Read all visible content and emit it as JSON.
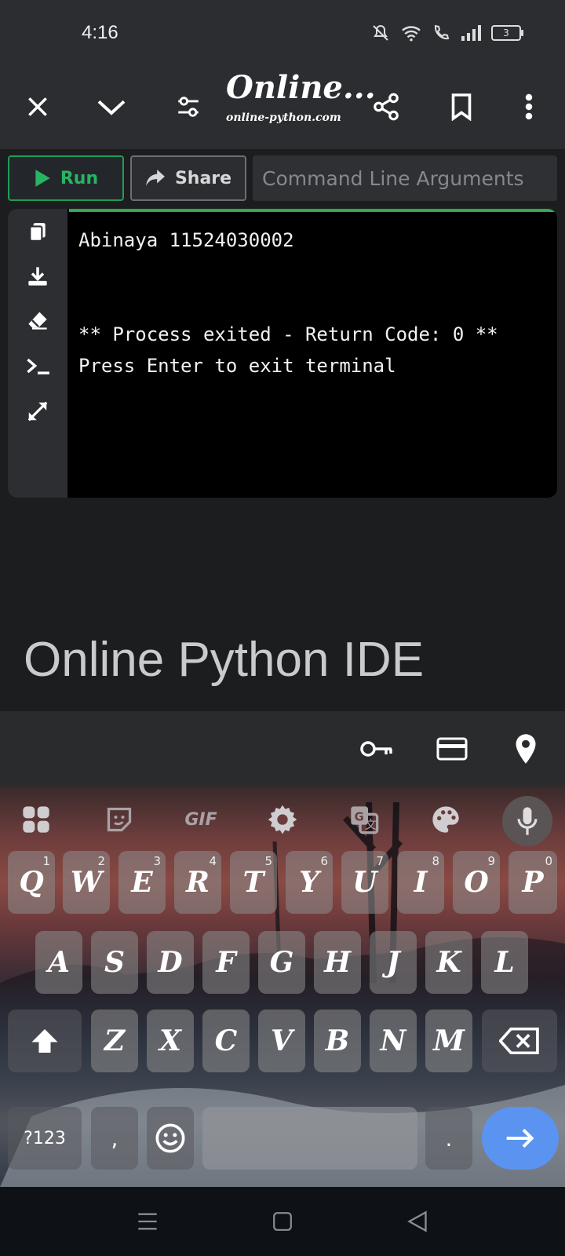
{
  "status": {
    "time": "4:16",
    "battery": "3"
  },
  "browser": {
    "title": "Online...",
    "domain": "online-python.com",
    "icons": [
      "close-icon",
      "chevron-down-icon",
      "tune-icon",
      "share-icon",
      "bookmark-icon",
      "more-vert-icon"
    ]
  },
  "controls": {
    "run_label": "Run",
    "share_label": "Share",
    "args_placeholder": "Command Line Arguments"
  },
  "terminal": {
    "sidebar_icons": [
      "copy-icon",
      "download-icon",
      "eraser-icon",
      "terminal-icon",
      "expand-icon"
    ],
    "lines": [
      "Abinaya 11524030002",
      "",
      "",
      "** Process exited - Return Code: 0 **",
      "Press Enter to exit terminal"
    ]
  },
  "heading": "Online Python IDE",
  "autofill": {
    "icons": [
      "key-icon",
      "credit-card-icon",
      "location-pin-icon"
    ]
  },
  "keyboard": {
    "toolbar": {
      "gif_label": "GIF",
      "icons": [
        "apps-grid-icon",
        "sticker-icon",
        "gif-icon",
        "settings-icon",
        "translate-icon",
        "palette-icon",
        "mic-icon"
      ]
    },
    "row1": [
      {
        "k": "Q",
        "n": "1"
      },
      {
        "k": "W",
        "n": "2"
      },
      {
        "k": "E",
        "n": "3"
      },
      {
        "k": "R",
        "n": "4"
      },
      {
        "k": "T",
        "n": "5"
      },
      {
        "k": "Y",
        "n": "6"
      },
      {
        "k": "U",
        "n": "7"
      },
      {
        "k": "I",
        "n": "8"
      },
      {
        "k": "O",
        "n": "9"
      },
      {
        "k": "P",
        "n": "0"
      }
    ],
    "row2": [
      "A",
      "S",
      "D",
      "F",
      "G",
      "H",
      "J",
      "K",
      "L"
    ],
    "row3": [
      "Z",
      "X",
      "C",
      "V",
      "B",
      "N",
      "M"
    ],
    "symbols_label": "?123",
    "comma": ",",
    "period": "."
  },
  "nav": {
    "icons": [
      "recents-icon",
      "home-icon",
      "back-icon"
    ]
  }
}
